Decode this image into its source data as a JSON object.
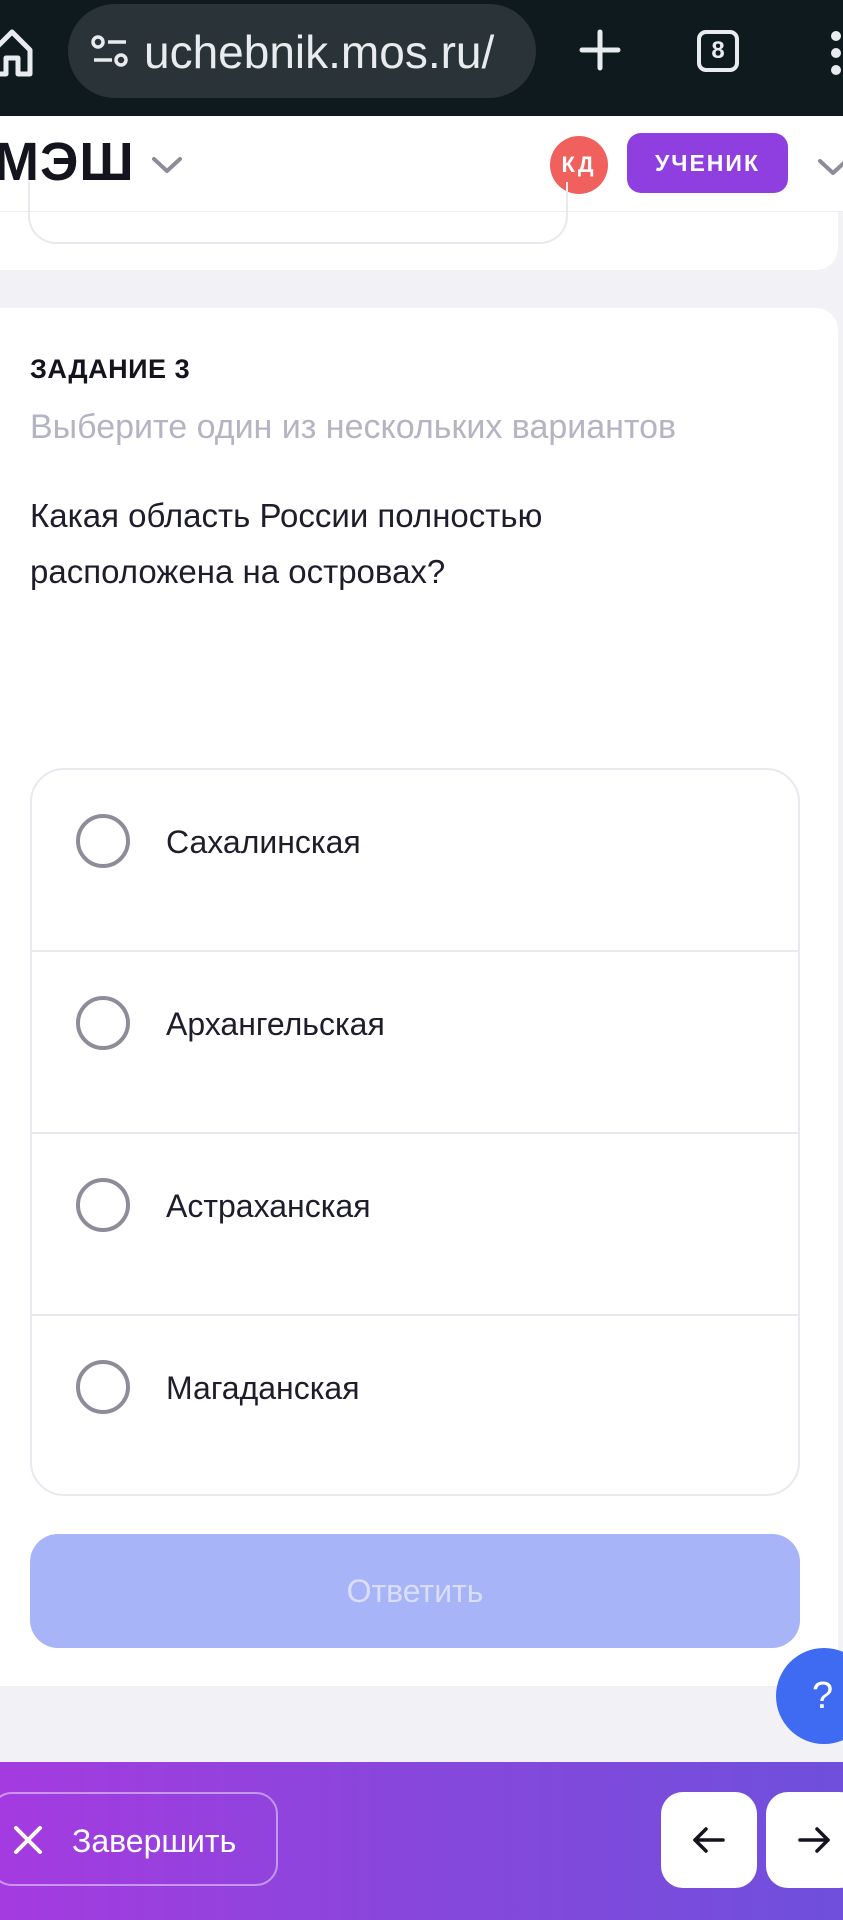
{
  "browser": {
    "url": "uchebnik.mos.ru/",
    "tabs_count": "8"
  },
  "header": {
    "logo": "МЭШ",
    "avatar_initials": "КД",
    "role": "УЧЕНИК"
  },
  "task": {
    "title": "ЗАДАНИЕ 3",
    "hint": "Выберите один из нескольких вариантов",
    "question": "Какая область России полностью расположена на островах?",
    "options": [
      {
        "label": "Сахалинская"
      },
      {
        "label": "Архангельская"
      },
      {
        "label": "Астраханская"
      },
      {
        "label": "Магаданская"
      }
    ],
    "answer_label": "Ответить"
  },
  "help": {
    "label": "?"
  },
  "footer": {
    "finish_label": "Завершить"
  }
}
